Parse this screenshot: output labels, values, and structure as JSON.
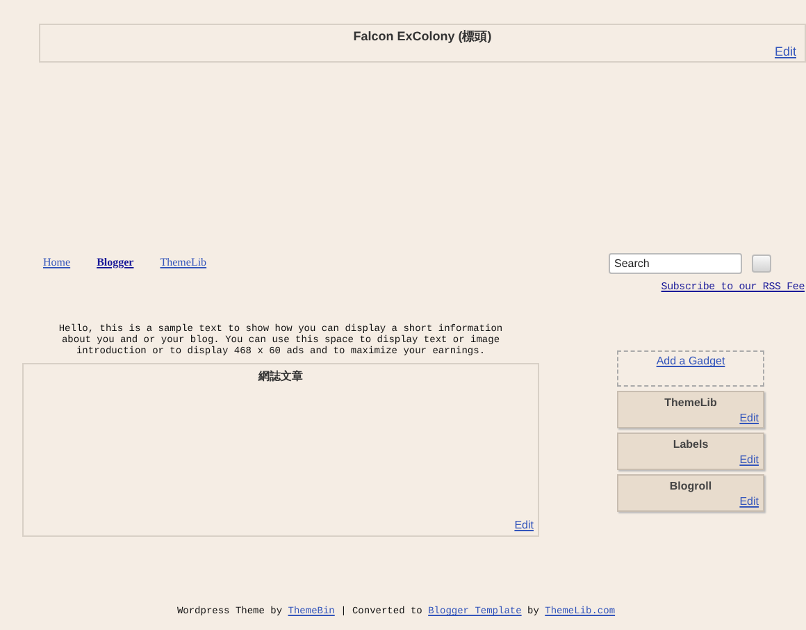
{
  "header": {
    "title": "Falcon ExColony (標頭)",
    "edit": "Edit"
  },
  "nav": [
    {
      "label": "Home",
      "selected": false
    },
    {
      "label": "Blogger",
      "selected": true
    },
    {
      "label": "ThemeLib",
      "selected": false
    }
  ],
  "search": {
    "placeholder": "Search"
  },
  "subscribe": "Subscribe to our RSS Fee",
  "intro": "Hello, this is a sample text to show how you can display a short information about you and or your blog. You can use this space to display text or image introduction or to display 468 x 60 ads and to maximize your earnings.",
  "main": {
    "title": "網誌文章",
    "edit": "Edit"
  },
  "sidebar": {
    "add_gadget": "Add a Gadget",
    "widgets": [
      {
        "title": "ThemeLib",
        "edit": "Edit"
      },
      {
        "title": "Labels",
        "edit": "Edit"
      },
      {
        "title": "Blogroll",
        "edit": "Edit"
      }
    ]
  },
  "footer": {
    "parts": [
      {
        "kind": "text",
        "text": "Wordpress Theme by "
      },
      {
        "kind": "link",
        "text": "ThemeBin"
      },
      {
        "kind": "text",
        "text": " | Converted to "
      },
      {
        "kind": "link",
        "text": "Blogger Template"
      },
      {
        "kind": "text",
        "text": " by "
      },
      {
        "kind": "link",
        "text": "ThemeLib.com"
      }
    ]
  }
}
